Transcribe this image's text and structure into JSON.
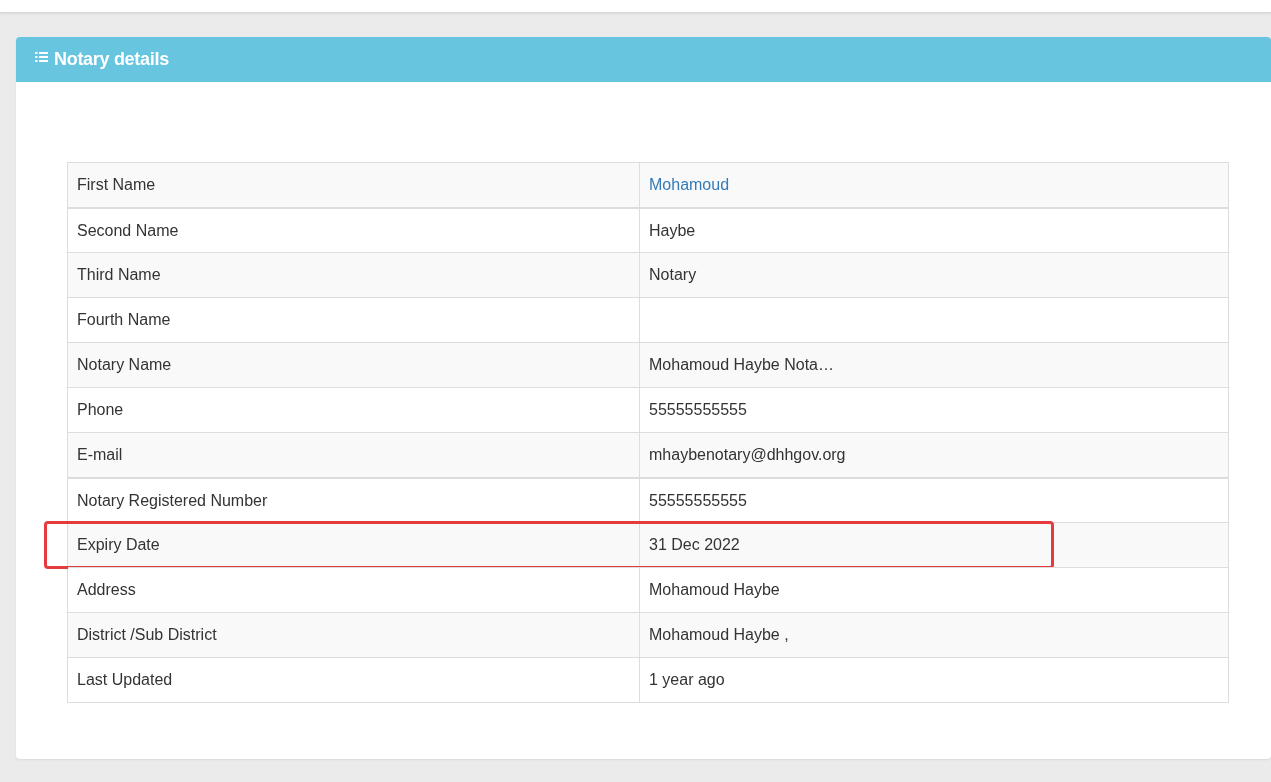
{
  "panel": {
    "title": "Notary details"
  },
  "rows": [
    {
      "label": "First Name",
      "value": "Mohamoud",
      "kind": "link",
      "highlighted": false
    },
    {
      "label": "Second Name",
      "value": "Haybe",
      "kind": "text",
      "highlighted": false
    },
    {
      "label": "Third Name",
      "value": "Notary",
      "kind": "text",
      "highlighted": false
    },
    {
      "label": "Fourth Name",
      "value": "",
      "kind": "text",
      "highlighted": false
    },
    {
      "label": "Notary Name",
      "value": "Mohamoud Haybe Nota…",
      "kind": "text",
      "highlighted": false
    },
    {
      "label": "Phone",
      "value": "55555555555",
      "kind": "text",
      "highlighted": false
    },
    {
      "label": "E-mail",
      "value": "mhaybenotary@dhhgov.org",
      "kind": "text",
      "highlighted": false
    },
    {
      "label": "Notary Registered Number",
      "value": "55555555555",
      "kind": "text",
      "highlighted": false
    },
    {
      "label": "Expiry Date",
      "value": "31 Dec 2022",
      "kind": "text",
      "highlighted": true
    },
    {
      "label": "Address",
      "value": "Mohamoud Haybe",
      "kind": "text",
      "highlighted": false
    },
    {
      "label": "District /Sub District",
      "value": "Mohamoud Haybe ,",
      "kind": "text",
      "highlighted": false
    },
    {
      "label": "Last Updated",
      "value": "1 year ago",
      "kind": "text",
      "highlighted": false
    }
  ]
}
